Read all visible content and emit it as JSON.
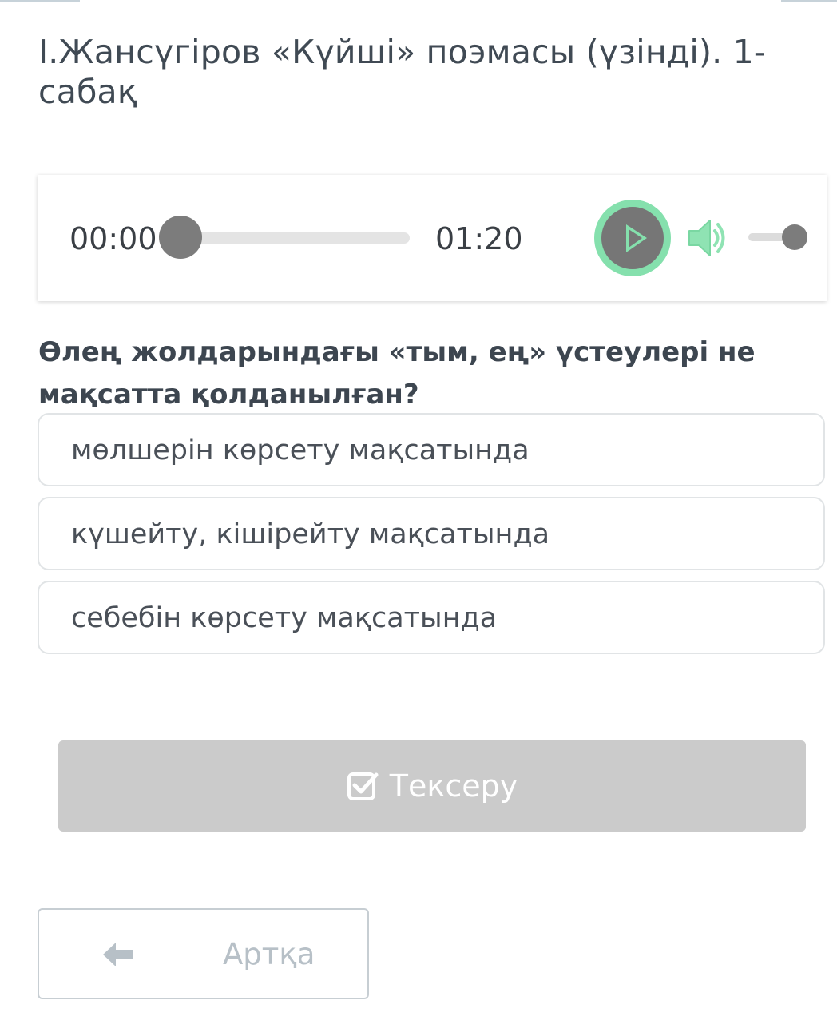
{
  "lesson": {
    "title": "І.Жансүгіров «Күйші» поэмасы (үзінді). 1-сабақ"
  },
  "audio_player": {
    "current_time": "00:00",
    "total_time": "01:20",
    "progress": 0,
    "volume": 1,
    "play_icon": "play-icon",
    "volume_icon": "volume-icon",
    "accent_color": "#85e0ad"
  },
  "question": {
    "text": "Өлең жолдарындағы «тым, ең» үстеулері не мақсатта қолданылған?",
    "options": [
      "мөлшерін көрсету мақсатында",
      "күшейту, кішірейту мақсатында",
      "себебін көрсету мақсатында"
    ]
  },
  "actions": {
    "check_label": "Тексеру",
    "check_icon": "checkbox-icon",
    "back_label": "Артқа",
    "back_icon": "arrow-left-icon"
  }
}
